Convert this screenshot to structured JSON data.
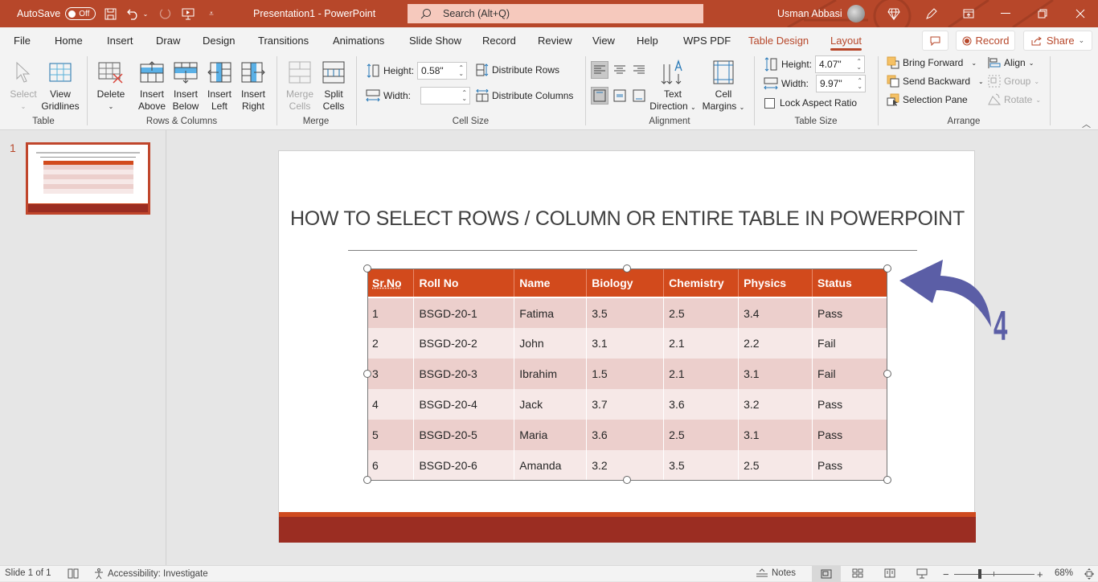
{
  "titlebar": {
    "autosave_label": "AutoSave",
    "autosave_state": "Off",
    "document_title": "Presentation1  -  PowerPoint",
    "search_placeholder": "Search (Alt+Q)",
    "user_name": "Usman Abbasi"
  },
  "menu": {
    "tabs": [
      {
        "label": "File"
      },
      {
        "label": "Home"
      },
      {
        "label": "Insert"
      },
      {
        "label": "Draw"
      },
      {
        "label": "Design"
      },
      {
        "label": "Transitions"
      },
      {
        "label": "Animations"
      },
      {
        "label": "Slide Show"
      },
      {
        "label": "Record"
      },
      {
        "label": "Review"
      },
      {
        "label": "View"
      },
      {
        "label": "Help"
      },
      {
        "label": "WPS PDF"
      },
      {
        "label": "Table Design"
      },
      {
        "label": "Layout"
      }
    ],
    "active_tab": "Layout",
    "record_button": "Record",
    "share_button": "Share"
  },
  "ribbon": {
    "table_group": {
      "label": "Table",
      "select": "Select",
      "view_gridlines_1": "View",
      "view_gridlines_2": "Gridlines"
    },
    "rows_columns_group": {
      "label": "Rows & Columns",
      "delete": "Delete",
      "insert_above_1": "Insert",
      "insert_above_2": "Above",
      "insert_below_1": "Insert",
      "insert_below_2": "Below",
      "insert_left_1": "Insert",
      "insert_left_2": "Left",
      "insert_right_1": "Insert",
      "insert_right_2": "Right"
    },
    "merge_group": {
      "label": "Merge",
      "merge_cells_1": "Merge",
      "merge_cells_2": "Cells",
      "split_cells_1": "Split",
      "split_cells_2": "Cells"
    },
    "cell_size_group": {
      "label": "Cell Size",
      "height_label": "Height:",
      "height_value": "0.58\"",
      "width_label": "Width:",
      "width_value": "",
      "distribute_rows": "Distribute Rows",
      "distribute_columns": "Distribute Columns"
    },
    "alignment_group": {
      "label": "Alignment",
      "text_direction_1": "Text",
      "text_direction_2": "Direction",
      "cell_margins_1": "Cell",
      "cell_margins_2": "Margins"
    },
    "table_size_group": {
      "label": "Table Size",
      "height_label": "Height:",
      "height_value": "4.07\"",
      "width_label": "Width:",
      "width_value": "9.97\"",
      "lock_aspect_ratio": "Lock Aspect Ratio",
      "lock_aspect_checked": false
    },
    "arrange_group": {
      "label": "Arrange",
      "bring_forward": "Bring Forward",
      "send_backward": "Send Backward",
      "selection_pane": "Selection Pane",
      "align": "Align",
      "group": "Group",
      "rotate": "Rotate"
    }
  },
  "thumbnails": [
    {
      "number": "1"
    }
  ],
  "slide": {
    "title": "HOW TO SELECT ROWS / COLUMN OR ENTIRE TABLE IN POWERPOINT",
    "annotation_number": "4",
    "table": {
      "headers": [
        "Sr.No",
        "Roll No",
        "Name",
        "Biology",
        "Chemistry",
        "Physics",
        "Status"
      ],
      "rows": [
        [
          "1",
          "BSGD-20-1",
          "Fatima",
          "3.5",
          "2.5",
          "3.4",
          "Pass"
        ],
        [
          "2",
          "BSGD-20-2",
          "John",
          "3.1",
          "2.1",
          "2.2",
          "Fail"
        ],
        [
          "3",
          "BSGD-20-3",
          "Ibrahim",
          "1.5",
          "2.1",
          "3.1",
          "Fail"
        ],
        [
          "4",
          "BSGD-20-4",
          "Jack",
          "3.7",
          "3.6",
          "3.2",
          "Pass"
        ],
        [
          "5",
          "BSGD-20-5",
          "Maria",
          "3.6",
          "2.5",
          "3.1",
          "Pass"
        ],
        [
          "6",
          "BSGD-20-6",
          "Amanda",
          "3.2",
          "3.5",
          "2.5",
          "Pass"
        ]
      ]
    }
  },
  "statusbar": {
    "slide_indicator": "Slide 1 of 1",
    "accessibility": "Accessibility: Investigate",
    "notes": "Notes",
    "zoom_level": "68%"
  },
  "colors": {
    "accent": "#b7472a",
    "table_header": "#d24a1c",
    "annotation": "#5b5ea6"
  }
}
